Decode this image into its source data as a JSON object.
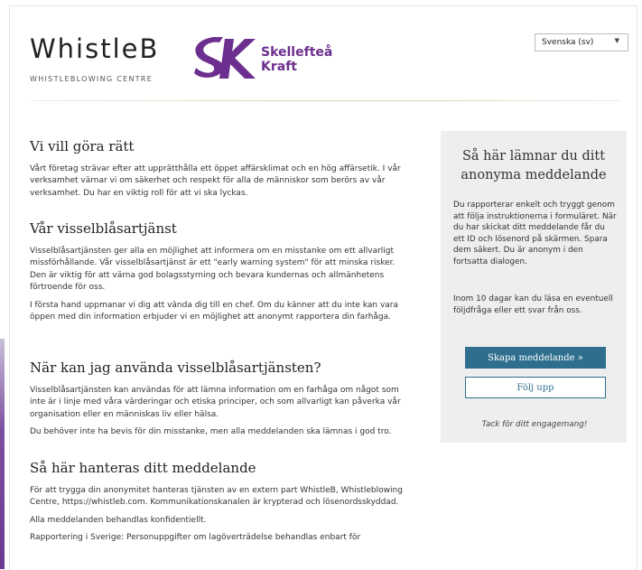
{
  "header": {
    "logo_text": "WhistleB",
    "logo_subtitle": "WHISTLEBLOWING CENTRE",
    "brand_line1": "Skellefteå",
    "brand_line2": "Kraft",
    "brand_color": "#6c2f8f",
    "language_selected": "Svenska (sv)"
  },
  "main": {
    "sections": [
      {
        "heading": "Vi vill göra rätt",
        "paragraphs": [
          "Vårt företag strävar efter att upprätthålla ett öppet affärsklimat och en hög affärsetik. I vår verksamhet värnar vi om säkerhet och respekt för alla de människor som berörs av vår verksamhet. Du har en viktig roll för att vi ska lyckas."
        ]
      },
      {
        "heading": "Vår visselblåsartjänst",
        "paragraphs": [
          "Visselblåsartjänsten ger alla en möjlighet att informera om en misstanke om ett allvarligt missförhållande. Vår visselblåsartjänst är ett \"early warning system\" för att minska risker. Den är viktig för att värna god bolagsstyrning och bevara kundernas och allmänhetens förtroende för oss.",
          "I första hand uppmanar vi dig att vända dig till en chef. Om du känner att du inte kan vara öppen med din information erbjuder vi en möjlighet att anonymt rapportera din farhåga."
        ]
      },
      {
        "heading": "När kan jag använda visselblåsartjänsten?",
        "paragraphs": [
          "Visselblåsartjänsten kan användas för att lämna information om en farhåga om något som inte är i linje med våra värderingar och etiska principer, och som allvarligt kan påverka vår organisation eller en människas liv eller hälsa.",
          "Du behöver inte ha bevis för din misstanke, men alla meddelanden ska lämnas i god tro."
        ]
      },
      {
        "heading": "Så här hanteras ditt meddelande",
        "paragraphs": [
          "För att trygga din anonymitet hanteras tjänsten av en extern part WhistleB, Whistleblowing Centre, https://whistleb.com. Kommunikationskanalen är krypterad och lösenordsskyddad.",
          "Alla meddelanden behandlas konfidentiellt.",
          "Rapportering i Sverige: Personuppgifter om lagöverträdelse behandlas enbart för"
        ]
      }
    ]
  },
  "sidebar": {
    "title": "Så här lämnar du ditt anonyma meddelande",
    "text1": "Du rapporterar enkelt och tryggt genom att följa instruktionerna i formuläret. När du har skickat ditt meddelande får du ett ID och lösenord på skärmen. Spara dem säkert. Du är anonym i den fortsatta dialogen.",
    "text2": "Inom 10 dagar kan du läsa en eventuell följdfråga eller ett svar från oss.",
    "create_button": "Skapa meddelande »",
    "follow_button": "Följ upp",
    "thanks": "Tack för ditt engagemang!",
    "accent_color": "#2f6f8d"
  }
}
